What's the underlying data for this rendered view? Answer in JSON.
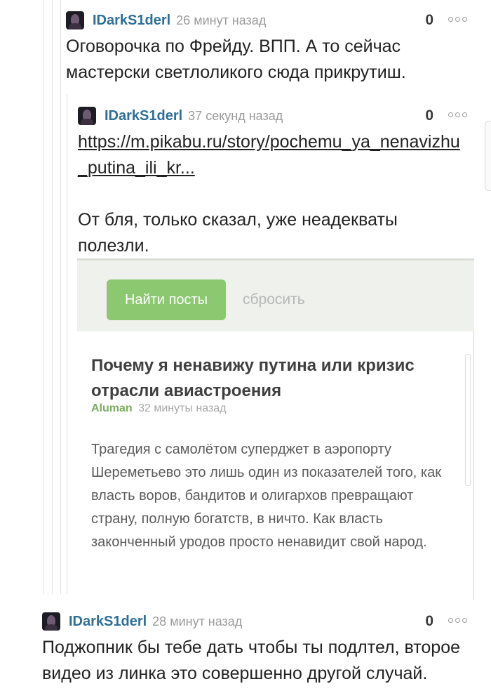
{
  "comments": [
    {
      "author": "IDarkS1derl",
      "time": "26 минут назад",
      "rating": "0",
      "text": "Оговорочка по Фрейду. ВПП. А то сейчас мастерски светлоликого сюда прикрутиш."
    },
    {
      "author": "IDarkS1derl",
      "time": "37 секунд назад",
      "rating": "0",
      "link": "https://m.pikabu.ru/story/pochemu_ya_nenavizhu_putina_ili_kr...",
      "text": "От бля, только сказал, уже неадекваты полезли."
    },
    {
      "author": "IDarkS1derl",
      "time": "28 минут назад",
      "rating": "0",
      "text": "Поджопник бы тебе дать чтобы ты подлтел, второе видео из линка это совершенно другой случай."
    }
  ],
  "embed": {
    "find_button": "Найти посты",
    "reset_link": "сбросить",
    "post": {
      "title": "Почему я ненавижу путина или кризис отрасли авиастроения",
      "author": "Aluman",
      "time": "32 минуты назад",
      "excerpt": "Трагедия с самолётом суперджет в аэропорту Шереметьево это лишь один из показателей того, как власть воров, бандитов и олигархов превращают страну, полную богатств, в ничто. Как власть законченный уродов просто ненавидит свой народ."
    }
  }
}
